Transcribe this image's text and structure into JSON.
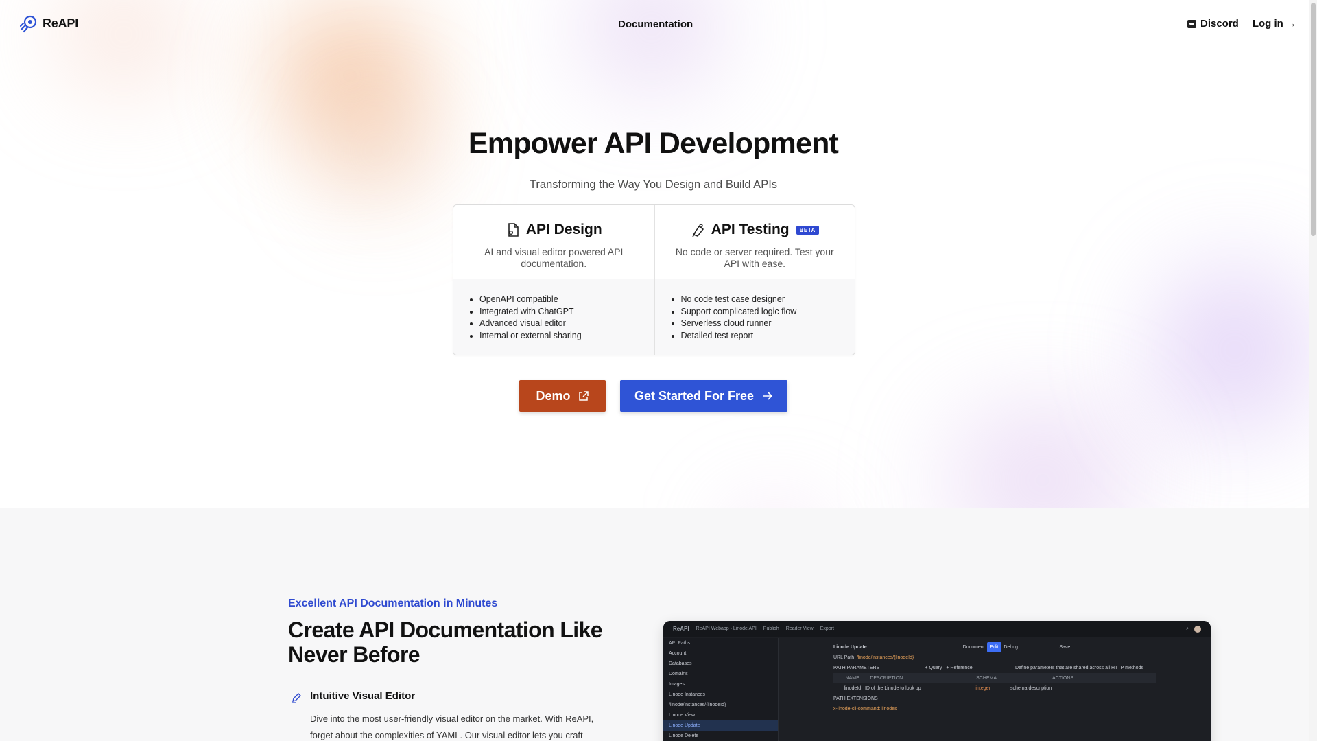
{
  "header": {
    "brand": "ReAPI",
    "nav_documentation": "Documentation",
    "discord": "Discord",
    "login": "Log in →"
  },
  "hero": {
    "title": "Empower API Development",
    "subtitle": "Transforming the Way You Design and Build APIs"
  },
  "cards": [
    {
      "title": "API Design",
      "icon": "document-icon",
      "desc": "AI and visual editor powered API documentation.",
      "features": [
        "OpenAPI compatible",
        "Integrated with ChatGPT",
        "Advanced visual editor",
        "Internal or external sharing"
      ]
    },
    {
      "title": "API Testing",
      "icon": "test-icon",
      "badge": "BETA",
      "desc": "No code or server required. Test your API with ease.",
      "features": [
        "No code test case designer",
        "Support complicated logic flow",
        "Serverless cloud runner",
        "Detailed test report"
      ]
    }
  ],
  "buttons": {
    "demo": "Demo",
    "get_started": "Get Started For Free"
  },
  "section2": {
    "eyebrow": "Excellent API Documentation in Minutes",
    "title": "Create API Documentation Like Never Before",
    "feature_title": "Intuitive Visual Editor",
    "feature_text": "Dive into the most user-friendly visual editor on the market. With ReAPI, forget about the complexities of YAML. Our visual editor lets you craft"
  },
  "mock": {
    "brand": "ReAPI",
    "breadcrumb": "ReAPI Webapp  ›  Linode API",
    "publish": "Publish",
    "reader_view": "Reader View",
    "export": "Export",
    "sidebar": {
      "header": "API Paths",
      "items": [
        "Account",
        "Databases",
        "Domains",
        "Images",
        "Linode Instances",
        "/linode/instances/{linodeId}",
        "Linode View",
        "Linode Update",
        "Linode Delete"
      ]
    },
    "main": {
      "title": "Linode Update",
      "tab_document": "Document",
      "tab_edit": "Edit",
      "tab_debug": "Debug",
      "save": "Save",
      "url_label": "URL Path",
      "url": "/linode/instances/{linodeId}",
      "path_params": "PATH PARAMETERS",
      "query": "+ Query",
      "reference": "+ Reference",
      "shared_note": "Define parameters that are shared across all HTTP methods",
      "cols": [
        "NAME",
        "DESCRIPTION",
        "SCHEMA",
        "ACTIONS"
      ],
      "param_name": "linodeId",
      "param_desc": "ID of the Linode to look up",
      "param_type": "integer",
      "param_schema_desc": "schema description",
      "path_ext": "PATH EXTENSIONS",
      "ext_value": "x-linode-cli-command: linodes"
    }
  },
  "colors": {
    "demo_button": "#b8461c",
    "primary_button": "#2f54d6",
    "accent_text": "#2f4ad0",
    "beta_badge": "#2f49d1"
  }
}
